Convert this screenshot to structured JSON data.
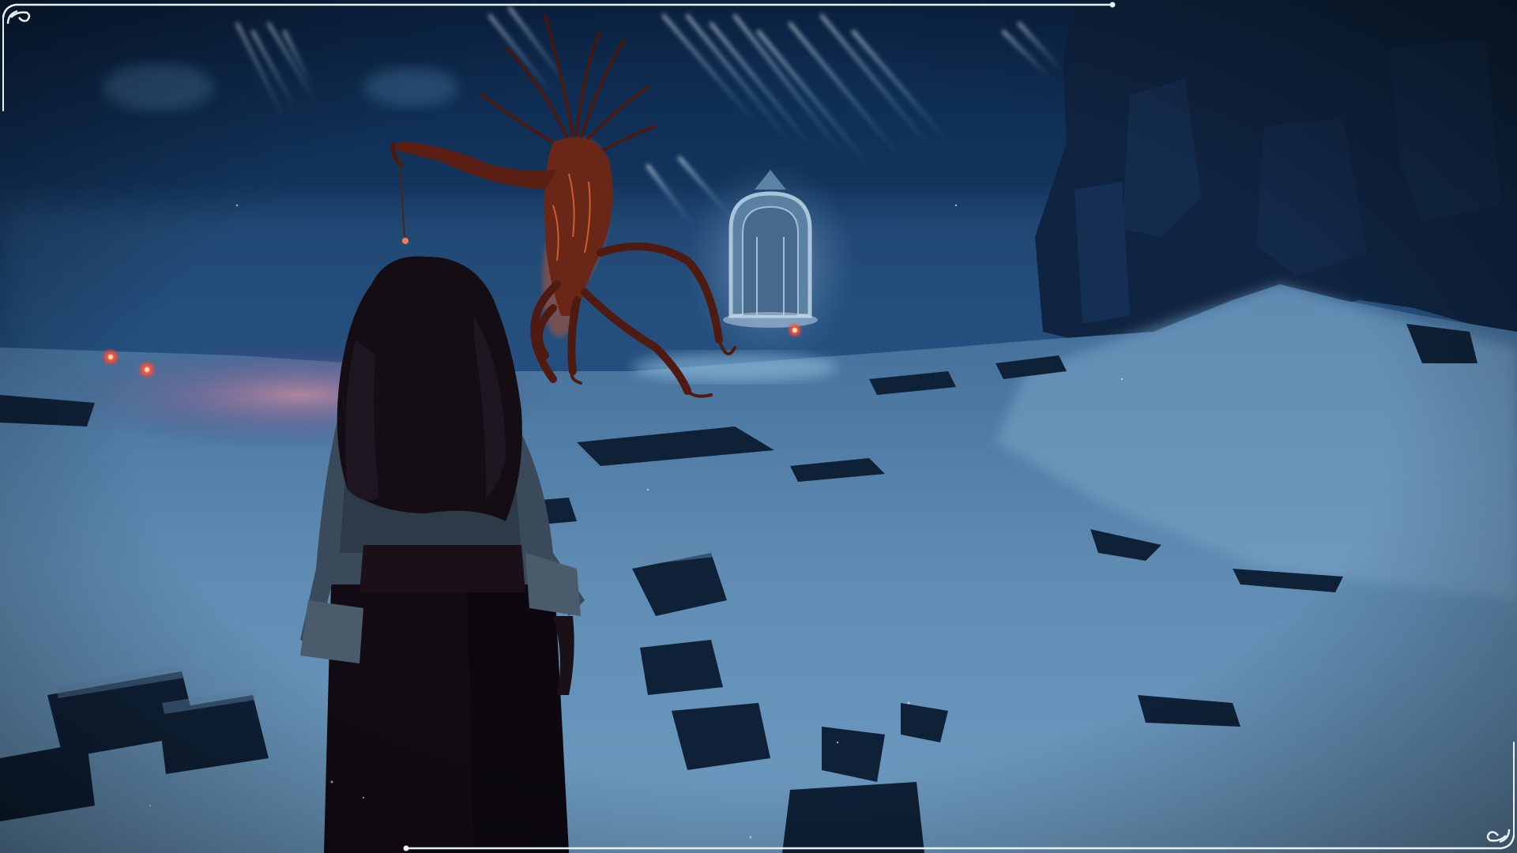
{
  "scene": {
    "colors": {
      "sky_top": "#0d2a4f",
      "sky_mid": "#1d4a78",
      "fog": "#2b5a88",
      "snow_light": "#7fa8c8",
      "snow_dark": "#1a3857",
      "cliff": "#0c1e33",
      "creature": "#6a2616",
      "creature_glow": "#d0552c",
      "ember": "#ff5a3c",
      "portal": "#a9c6da",
      "frame": "#e8f0f6"
    },
    "icons": {
      "frame_corner": "ornate-corner-icon"
    }
  }
}
